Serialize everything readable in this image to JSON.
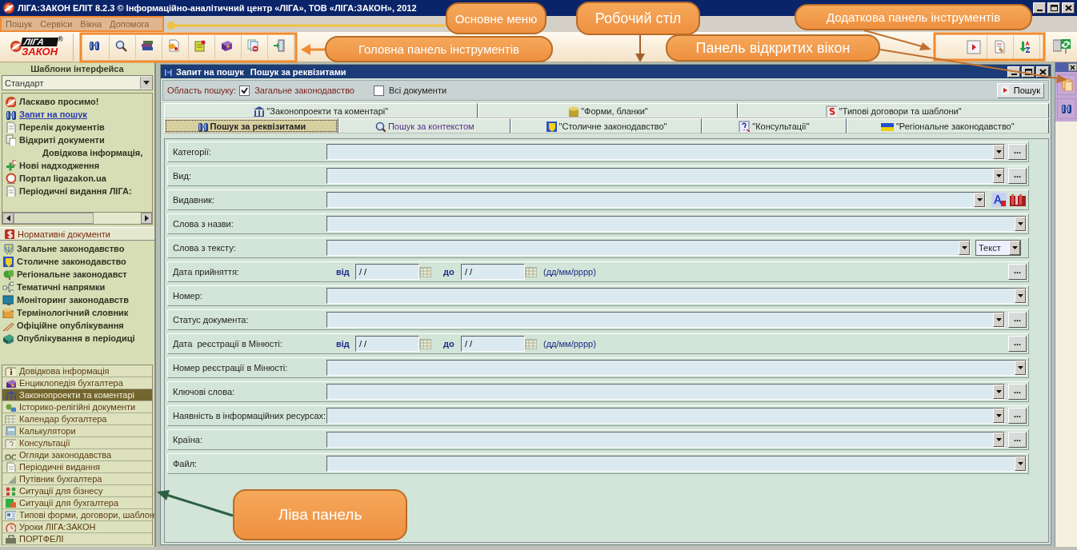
{
  "window": {
    "title": "ЛІГА:ЗАКОН ЕЛІТ 8.2.3 © Інформаційно-аналітичний центр «ЛІГА», ТОВ «ЛІГА:ЗАКОН», 2012"
  },
  "menu": [
    "Пошук",
    "Сервіси",
    "Вікна",
    "Допомога"
  ],
  "logo": {
    "top": "ЛІГА",
    "bottom": "ЗАКОН",
    "mark": "®"
  },
  "left_panel": {
    "title": "Шаблони інтерфейса",
    "template": "Стандарт",
    "items": [
      {
        "label": "Ласкаво просимо!",
        "kind": "item",
        "selected": false
      },
      {
        "label": "Запит на пошук",
        "kind": "item",
        "selected": true
      },
      {
        "label": "Перелік документів",
        "kind": "item",
        "selected": false
      },
      {
        "label": "Відкриті документи",
        "kind": "item",
        "selected": false
      },
      {
        "label": "Довідкова інформація,",
        "kind": "heading"
      },
      {
        "label": "Нові надходження",
        "kind": "item",
        "selected": false
      },
      {
        "label": "Портал ligazakon.ua",
        "kind": "item",
        "selected": false
      },
      {
        "label": "Періодичні видання ЛІГА:",
        "kind": "item",
        "selected": false
      }
    ],
    "section": "Нормативні документи",
    "section_items": [
      "Загальне законодавство",
      "Столичне законодавство",
      "Регіональне законодавст",
      "Тематичні напрямки",
      "Моніторинг законодавств",
      "Термінологічний словник",
      "Офіційне опублікування",
      "Опублікування в періодиці"
    ],
    "modules": [
      {
        "label": "Довідкова інформація",
        "selected": false
      },
      {
        "label": "Енциклопедія бухгалтера",
        "selected": false
      },
      {
        "label": "Законопроекти та коментарі",
        "selected": true
      },
      {
        "label": "Історико-релігійні документи",
        "selected": false
      },
      {
        "label": "Календар бухгалтера",
        "selected": false
      },
      {
        "label": "Калькулятори",
        "selected": false
      },
      {
        "label": "Консультації",
        "selected": false
      },
      {
        "label": "Огляди законодавства",
        "selected": false
      },
      {
        "label": "Періодичні видання",
        "selected": false
      },
      {
        "label": "Путівник бухгалтера",
        "selected": false
      },
      {
        "label": "Ситуації для бізнесу",
        "selected": false
      },
      {
        "label": "Ситуації для бухгалтера",
        "selected": false
      },
      {
        "label": "Типові форми, договори, шаблон",
        "selected": false
      },
      {
        "label": "Уроки ЛІГА:ЗАКОН",
        "selected": false
      },
      {
        "label": "ПОРТФЕЛІ",
        "selected": false
      }
    ]
  },
  "document": {
    "title": "Запит на пошук",
    "subtitle": "Пошук за реквізитами",
    "scope_label": "Область пошуку:",
    "scope_options": [
      {
        "label": "Загальне законодавство",
        "checked": true
      },
      {
        "label": "Всі документи",
        "checked": false
      }
    ],
    "search_button": "Пошук",
    "tab_rows": [
      [
        {
          "label": "\"Законопроекти та коментарі\"",
          "selected": false
        },
        {
          "label": "\"Форми, бланки\"",
          "selected": false
        },
        {
          "label": "\"Типові договори та шаблони\"",
          "selected": false
        }
      ],
      [
        {
          "label": "Пошук за реквізитами",
          "selected": true
        },
        {
          "label": "Пошук за контекстом",
          "selected": false
        },
        {
          "label": "\"Столичне законодавство\"",
          "selected": false
        },
        {
          "label": "\"Консультації\"",
          "selected": false
        },
        {
          "label": "\"Регіональне законодавство\"",
          "selected": false
        }
      ]
    ],
    "fields": [
      {
        "label": "Категорії:",
        "kind": "select",
        "more": "..."
      },
      {
        "label": "Вид:",
        "kind": "select",
        "more": "..."
      },
      {
        "label": "Видавник:",
        "kind": "select_extra"
      },
      {
        "label": "Слова з назви:",
        "kind": "select"
      },
      {
        "label": "Слова з тексту:",
        "kind": "select_type",
        "type_value": "Текст"
      },
      {
        "label": "Дата прийняття:",
        "kind": "date",
        "from_label": "від",
        "from_value": "/ /",
        "to_label": "до",
        "to_value": "/ /",
        "hint": "(дд/мм/рррр)",
        "more": "..."
      },
      {
        "label": "Номер:",
        "kind": "select"
      },
      {
        "label": "Статус документа:",
        "kind": "select",
        "more": "..."
      },
      {
        "label": "Дата  реєстрації в Мінюсті:",
        "kind": "date",
        "from_label": "від",
        "from_value": "/ /",
        "to_label": "до",
        "to_value": "/ /",
        "hint": "(дд/мм/рррр)",
        "more": "..."
      },
      {
        "label": "Номер реєстрації в Мінюсті:",
        "kind": "select"
      },
      {
        "label": "Ключові слова:",
        "kind": "select",
        "more": "..."
      },
      {
        "label": "Наявність в інформаційних ресурсах:",
        "kind": "select",
        "more": "..."
      },
      {
        "label": "Країна:",
        "kind": "select",
        "more": "..."
      },
      {
        "label": "Файл:",
        "kind": "select"
      }
    ]
  },
  "callouts": [
    "Основне меню",
    "Робочий стіл",
    "Додаткова панель інструментів",
    "Головна панель інструментів",
    "Панель відкритих вікон",
    "Ліва панель"
  ]
}
